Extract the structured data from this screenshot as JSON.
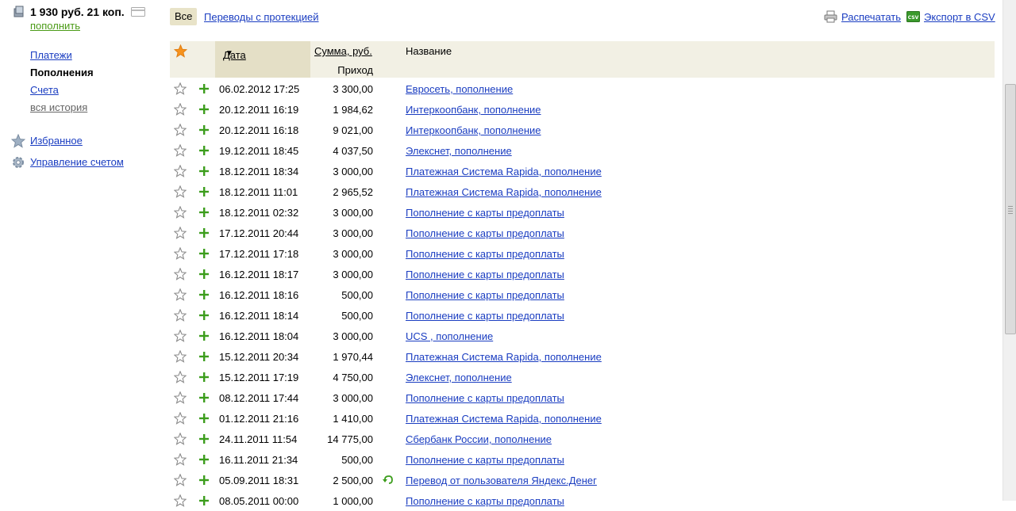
{
  "account": {
    "balance": "1 930 руб. 21 коп.",
    "topup_label": "пополнить"
  },
  "nav": {
    "payments": "Платежи",
    "topups": "Пополнения",
    "accounts": "Счета",
    "history": "вся история"
  },
  "extra": {
    "favorites": "Избранное",
    "account_settings": "Управление счетом"
  },
  "filters": {
    "all": "Все",
    "protected": "Переводы с протекцией"
  },
  "actions": {
    "print": "Распечатать",
    "export": "Экспорт в CSV",
    "csv_badge": "CSV"
  },
  "table": {
    "col_date": "Дата",
    "sort_indicator": "▼",
    "col_amount": "Сумма, руб.",
    "col_income": "Приход",
    "col_name": "Название",
    "rows": [
      {
        "date": "06.02.2012 17:25",
        "amount": "3 300,00",
        "name": "Евросеть, пополнение"
      },
      {
        "date": "20.12.2011 16:19",
        "amount": "1 984,62",
        "name": "Интеркоопбанк, пополнение"
      },
      {
        "date": "20.12.2011 16:18",
        "amount": "9 021,00",
        "name": "Интеркоопбанк, пополнение"
      },
      {
        "date": "19.12.2011 18:45",
        "amount": "4 037,50",
        "name": "Элекснет, пополнение"
      },
      {
        "date": "18.12.2011 18:34",
        "amount": "3 000,00",
        "name": "Платежная Система Rapida, пополнение"
      },
      {
        "date": "18.12.2011 11:01",
        "amount": "2 965,52",
        "name": "Платежная Система Rapida, пополнение"
      },
      {
        "date": "18.12.2011 02:32",
        "amount": "3 000,00",
        "name": "Пополнение с карты предоплаты"
      },
      {
        "date": "17.12.2011 20:44",
        "amount": "3 000,00",
        "name": "Пополнение с карты предоплаты"
      },
      {
        "date": "17.12.2011 17:18",
        "amount": "3 000,00",
        "name": "Пополнение с карты предоплаты"
      },
      {
        "date": "16.12.2011 18:17",
        "amount": "3 000,00",
        "name": "Пополнение с карты предоплаты"
      },
      {
        "date": "16.12.2011 18:16",
        "amount": "500,00",
        "name": "Пополнение с карты предоплаты"
      },
      {
        "date": "16.12.2011 18:14",
        "amount": "500,00",
        "name": "Пополнение с карты предоплаты"
      },
      {
        "date": "16.12.2011 18:04",
        "amount": "3 000,00",
        "name": "UCS , пополнение"
      },
      {
        "date": "15.12.2011 20:34",
        "amount": "1 970,44",
        "name": "Платежная Система Rapida, пополнение"
      },
      {
        "date": "15.12.2011 17:19",
        "amount": "4 750,00",
        "name": "Элекснет, пополнение"
      },
      {
        "date": "08.12.2011 17:44",
        "amount": "3 000,00",
        "name": "Пополнение с карты предоплаты"
      },
      {
        "date": "01.12.2011 21:16",
        "amount": "1 410,00",
        "name": "Платежная Система Rapida, пополнение"
      },
      {
        "date": "24.11.2011 11:54",
        "amount": "14 775,00",
        "name": "Сбербанк России, пополнение"
      },
      {
        "date": "16.11.2011 21:34",
        "amount": "500,00",
        "name": "Пополнение с карты предоплаты"
      },
      {
        "date": "05.09.2011 18:31",
        "amount": "2 500,00",
        "name": "Перевод от пользователя Яндекс.Денег",
        "return_icon": true
      },
      {
        "date": "08.05.2011 00:00",
        "amount": "1 000,00",
        "name": "Пополнение с карты предоплаты"
      }
    ]
  },
  "colors": {
    "link": "#1a3dc1",
    "topup_link": "#4b9b17",
    "plus": "#3c9d1c",
    "star_active": "#f7931e",
    "header_bg": "#f2f0e4",
    "sorted_col_bg": "#e4dfc6",
    "filter_active_bg": "#e8e3c8"
  },
  "icons": {
    "wallet": "wallet-icon",
    "card": "card-icon",
    "favorites": "star-icon",
    "settings": "gear-icon",
    "print": "printer-icon",
    "export": "csv-icon",
    "favorite_row": "star-outline-icon",
    "income": "plus-icon",
    "return": "return-arrow-icon"
  }
}
